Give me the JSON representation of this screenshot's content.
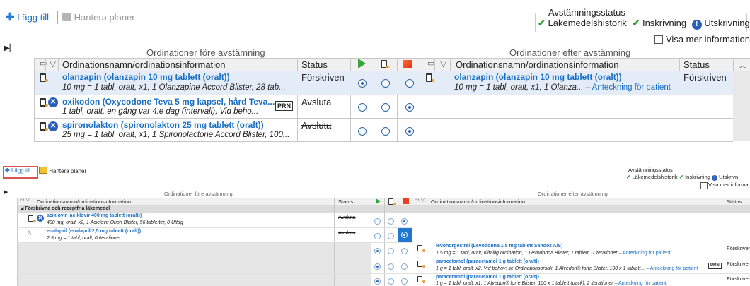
{
  "top": {
    "toolbar": {
      "add_label": "Lägg till",
      "manage_label": "Hantera planer"
    },
    "status_box": {
      "title": "Avstämningsstatus",
      "items": [
        "Läkemedelshistorik",
        "Inskrivning",
        "Utskrivning"
      ],
      "more_info": "Visa mer information"
    },
    "section_before": "Ordinationer före avstämning",
    "section_after": "Ordinationer efter avstämning",
    "col_name": "Ordinationsnamn/ordinationsinformation",
    "col_status": "Status",
    "rows": [
      {
        "left_title": "olanzapin (olanzapin 10 mg tablett (oralt))",
        "left_detail": "10 mg = 1 tabl, oralt, x1, 1 Olanzapine Accord Blister, 28 tab...",
        "left_status": "Förskriven",
        "right_title": "olanzapin (olanzapin 10 mg tablett (oralt))",
        "right_detail": "10 mg = 1 tabl, oralt, x1, 1 Olanza...",
        "right_link": "– Anteckning för patient",
        "right_status": "Förskriven"
      },
      {
        "left_title": "oxikodon (Oxycodone Teva 5 mg kapsel, hård Teva...",
        "left_detail": "1 tabl, oralt, en gång var 4:e dag (intervall), Vid beho...",
        "prn": "PRN",
        "left_status": "Avsluta"
      },
      {
        "left_title": "spironolakton (spironolakton 25 mg tablett (oralt))",
        "left_detail": "25 mg = 1 tabl, oralt, x1, 1 Spironolactone Accord Blister, 100...",
        "left_status": "Avsluta"
      }
    ]
  },
  "bottom": {
    "toolbar": {
      "add_label": "Lägg till",
      "manage_label": "Hantera planer"
    },
    "status_box": {
      "title": "Avstämningsstatus",
      "items": [
        "Läkemedelshistorik",
        "Inskrivning",
        "Utskrivn"
      ],
      "more_info": "Visa mer informati"
    },
    "section_before": "Ordinationer före avstämning",
    "section_after": "Ordinationer efter avstämning",
    "col_name": "Ordinationsnamn/ordinationsinformation",
    "col_status": "Status",
    "group_label": "Förskrivna och receptfria läkemedel",
    "left_rows": [
      {
        "title": "aciklovir (aciklovir 400 mg tablett (oralt))",
        "detail": "400 mg, oralt, x2, 1 Aciclovir Orion Blister, 56 tabletter, 0 Uttag",
        "status": "Avsluta"
      },
      {
        "title": "enalapril (enalapril 2,5 mg tablett (oralt))",
        "detail": "2,5 mg = 1 tabl, oralt, 0 iterationer",
        "status": "Avsluta"
      }
    ],
    "right_rows": [
      {
        "title": "levonorgestrel (Levodonna 1,5 mg tablett Sandoz A/S)",
        "detail": "1,5 mg = 1 tabl, oralt, tillfällig ordination, 1 Levodonna Blister, 1 tablett, 0 iterationer",
        "link": "– Anteckning för patient",
        "status": "Förskriven"
      },
      {
        "title": "paracetamol (paracetamol 1 g tablett (oralt))",
        "detail": "1 g = 1 tabl, oralt, x2, Vid behov: se Ordinationsorsak, 1 Alvedon® forte Blister, 100 x 1 tablett...",
        "link": "– Anteckning för patient",
        "prn": "PRN",
        "status": "Förskriven"
      },
      {
        "title": "paracetamol (paracetamol 1 g tablett (oralt))",
        "detail": "1 g = 1 tabl, oralt, x1, 1 Alvedon® forte Blister, 100 x 1 tablett (pack), 2 iterationer",
        "link": "– Anteckning för patient",
        "status": "Förskriven"
      }
    ]
  }
}
